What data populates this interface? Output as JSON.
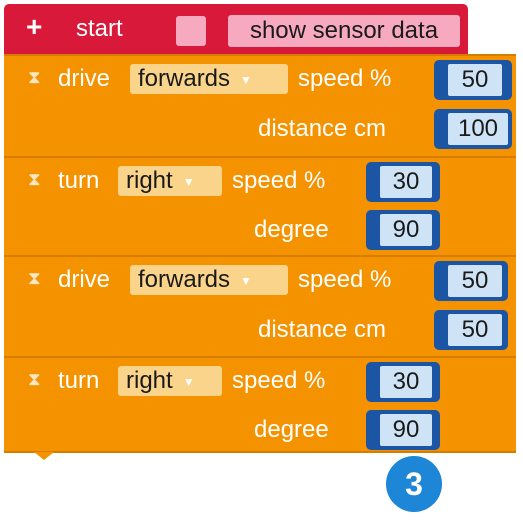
{
  "start_block": {
    "icon": "plus-icon",
    "label": "start",
    "checkbox": "unchecked",
    "show_sensor_label": "show sensor data"
  },
  "blocks": [
    {
      "icon": "hourglass-icon",
      "command": "drive",
      "direction": "forwards",
      "speed_label": "speed %",
      "speed": "50",
      "second_label": "distance cm",
      "second_value": "100"
    },
    {
      "icon": "hourglass-icon",
      "command": "turn",
      "direction": "right",
      "speed_label": "speed %",
      "speed": "30",
      "second_label": "degree",
      "second_value": "90"
    },
    {
      "icon": "hourglass-icon",
      "command": "drive",
      "direction": "forwards",
      "speed_label": "speed %",
      "speed": "50",
      "second_label": "distance cm",
      "second_value": "50"
    },
    {
      "icon": "hourglass-icon",
      "command": "turn",
      "direction": "right",
      "speed_label": "speed %",
      "speed": "30",
      "second_label": "degree",
      "second_value": "90"
    }
  ],
  "step_badge": "3",
  "colors": {
    "start": "#d8193a",
    "block": "#f49200",
    "dropdown": "#fbd48b",
    "socket": "#1b55a4",
    "number": "#cfe3f6",
    "badge": "#1e86d6"
  }
}
